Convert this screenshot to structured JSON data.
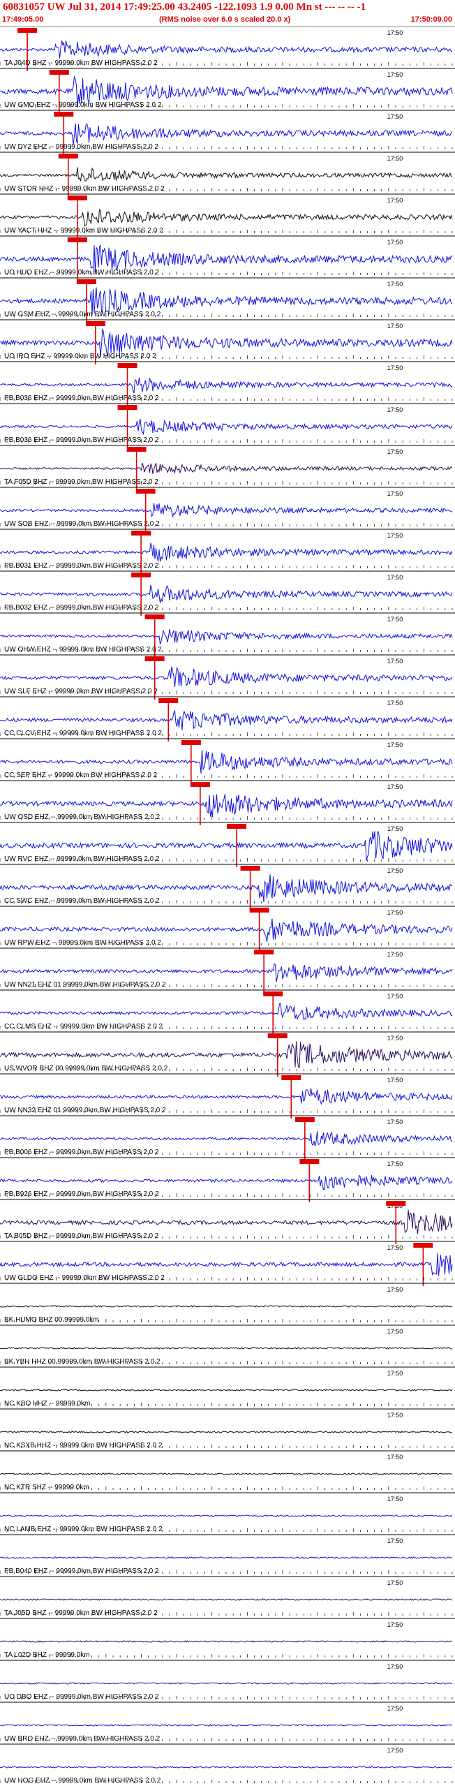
{
  "header": {
    "title": "60831057 UW Jul 31, 2014 17:49:25.00   43.2405 -122.1093  1.9 0.00 Mn st --- -- --  -1",
    "start_time": "17:49:05.00",
    "note": "(RMS noise over 6.0 s scaled 20.0 x)",
    "end_time": "17:50:09.00"
  },
  "chart_data": {
    "type": "line",
    "title": "60831057 UW Jul 31, 2014 17:49:25.00   43.2405 -122.1093  1.9 0.00 Mn st --- -- --  -1",
    "time_start": "17:49:05.00",
    "time_end": "17:50:09.00",
    "mid_tick_label": "17:50",
    "colors": {
      "trace_blue": "#1111dd",
      "trace_dark": "#2a0a5a",
      "trace_black": "#111111",
      "pick": "#e00000",
      "text": "#000000"
    },
    "traces": [
      {
        "label": "TA J04D BHZ -- 99999.0km BW  HIGHPASS  2.0  2",
        "color": "blue",
        "pick": 0.06,
        "event": 0.12,
        "amp": 0.6
      },
      {
        "label": "UW GMO EHZ -- 99999.0km BW  HIGHPASS  2.0  2",
        "color": "blue",
        "pick": 0.13,
        "event": 0.16,
        "amp": 1.0
      },
      {
        "label": "UW DY2 EHZ -- 99999.0km BW  HIGHPASS  2.0  2",
        "color": "blue",
        "pick": 0.14,
        "event": 0.16,
        "amp": 0.7
      },
      {
        "label": "UW STOR HHZ -- 99999.0km BW  HIGHPASS  2.0  2",
        "color": "black",
        "pick": 0.15,
        "event": 0.17,
        "amp": 0.5
      },
      {
        "label": "UW YACT HHZ -- 99999.0km BW  HIGHPASS  2.0  2",
        "color": "black",
        "pick": 0.17,
        "event": 0.18,
        "amp": 0.6
      },
      {
        "label": "UO HUO EHZ -- 99999.0km BW  HIGHPASS  2.0  2",
        "color": "blue",
        "pick": 0.17,
        "event": 0.2,
        "amp": 0.9
      },
      {
        "label": "UW GSM EHZ -- 99999.0km BW  HIGHPASS  2.0  2",
        "color": "blue",
        "pick": 0.19,
        "event": 0.2,
        "amp": 0.9
      },
      {
        "label": "UO IRO EHZ -- 99999.0km BW  HIGHPASS  2.0  2",
        "color": "blue",
        "pick": 0.21,
        "event": 0.22,
        "amp": 0.9
      },
      {
        "label": "PB B036 EHZ -- 99999.0km BW  HIGHPASS  2.0  2",
        "color": "blue",
        "pick": 0.28,
        "event": 0.29,
        "amp": 0.5
      },
      {
        "label": "PB B036 EHZ -- 99999.0km BW  HIGHPASS  2.0  2",
        "color": "blue",
        "pick": 0.28,
        "event": 0.3,
        "amp": 0.5
      },
      {
        "label": "TA F05D BHZ -- 99999.0km BW  HIGHPASS  2.0  2",
        "color": "dark",
        "pick": 0.3,
        "event": 0.31,
        "amp": 0.4
      },
      {
        "label": "UW SOB EHZ -- 99999.0km BW  HIGHPASS  2.0  2",
        "color": "blue",
        "pick": 0.32,
        "event": 0.33,
        "amp": 0.5
      },
      {
        "label": "PB B031 EHZ -- 99999.0km BW  HIGHPASS  2.0  2",
        "color": "blue",
        "pick": 0.31,
        "event": 0.33,
        "amp": 0.6
      },
      {
        "label": "PB B032 EHZ -- 99999.0km BW  HIGHPASS  2.0  2",
        "color": "blue",
        "pick": 0.31,
        "event": 0.33,
        "amp": 0.6
      },
      {
        "label": "UW OHW EHZ -- 99999.0km BW  HIGHPASS  2.0  2",
        "color": "blue",
        "pick": 0.34,
        "event": 0.35,
        "amp": 0.5
      },
      {
        "label": "UW SLF EHZ -- 99999.0km BW  HIGHPASS  2.0  2",
        "color": "blue",
        "pick": 0.34,
        "event": 0.37,
        "amp": 0.7
      },
      {
        "label": "CC CLCV EHZ -- 99999.0km BW  HIGHPASS  2.0  2",
        "color": "blue",
        "pick": 0.37,
        "event": 0.38,
        "amp": 0.7
      },
      {
        "label": "CC SEP EHZ -- 99999.0km BW  HIGHPASS  2.0  2",
        "color": "blue",
        "pick": 0.42,
        "event": 0.44,
        "amp": 0.7
      },
      {
        "label": "UW OSD EHZ -- 99999.0km BW  HIGHPASS  2.0  2",
        "color": "blue",
        "pick": 0.44,
        "event": 0.45,
        "amp": 0.9
      },
      {
        "label": "UW RVC EHZ -- 99999.0km BW  HIGHPASS  2.0  2",
        "color": "blue",
        "pick": 0.52,
        "event": 0.8,
        "amp": 1.0
      },
      {
        "label": "CC SWC EHZ -- 99999.0km BW  HIGHPASS  2.0  2",
        "color": "blue",
        "pick": 0.55,
        "event": 0.57,
        "amp": 0.9
      },
      {
        "label": "UW RPW EHZ -- 99999.0km BW  HIGHPASS  2.0  2",
        "color": "blue",
        "pick": 0.57,
        "event": 0.58,
        "amp": 0.8
      },
      {
        "label": "UW NN21 EHZ 01 99999.0km BW  HIGHPASS  2.0  2",
        "color": "blue",
        "pick": 0.58,
        "event": 0.6,
        "amp": 0.7
      },
      {
        "label": "CC CLMS EHZ -- 99999.0km BW  HIGHPASS  2.0  2",
        "color": "blue",
        "pick": 0.6,
        "event": 0.61,
        "amp": 0.6
      },
      {
        "label": "US WVOR BHZ 00 99999.0km BW  HIGHPASS  2.0  2",
        "color": "dark",
        "pick": 0.61,
        "event": 0.63,
        "amp": 0.9
      },
      {
        "label": "UW NN32 EHZ 01 99999.0km BW  HIGHPASS  2.0  2",
        "color": "blue",
        "pick": 0.64,
        "event": 0.66,
        "amp": 0.6
      },
      {
        "label": "PB B006 EHZ -- 99999.0km BW  HIGHPASS  2.0  2",
        "color": "blue",
        "pick": 0.67,
        "event": 0.68,
        "amp": 0.5
      },
      {
        "label": "PB B926 EHZ -- 99999.0km BW  HIGHPASS  2.0  2",
        "color": "blue",
        "pick": 0.68,
        "event": 0.7,
        "amp": 0.6
      },
      {
        "label": "TA B05D BHZ -- 99999.0km BW  HIGHPASS  2.0  2",
        "color": "dark",
        "pick": 0.87,
        "event": 0.89,
        "amp": 0.8
      },
      {
        "label": "UW GLDO EHZ -- 99999.0km BW  HIGHPASS  2.0  2",
        "color": "blue",
        "pick": 0.93,
        "event": 0.95,
        "amp": 0.8
      },
      {
        "label": "BK HUMO BHZ 00 99999.0km",
        "color": "black",
        "amp": 0.3
      },
      {
        "label": "BK YBH HHZ 00 99999.0km BW  HIGHPASS  2.0  2",
        "color": "black",
        "amp": 0.3
      },
      {
        "label": "NC KBO HHZ -- 99999.0km",
        "color": "black",
        "amp": 0.3
      },
      {
        "label": "NC KSXB HHZ -- 99999.0km BW  HIGHPASS  2.0  2",
        "color": "black",
        "amp": 0.3
      },
      {
        "label": "NC KTR SHZ -- 99999.0km",
        "color": "black",
        "amp": 0.3
      },
      {
        "label": "NC LAMB EHZ -- 99999.0km BW  HIGHPASS  2.0  2",
        "color": "blue",
        "amp": 0.3
      },
      {
        "label": "PB B040 EHZ -- 99999.0km BW  HIGHPASS  2.0  2",
        "color": "blue",
        "amp": 0.3
      },
      {
        "label": "TA J05D BHZ -- 99999.0km BW  HIGHPASS  2.0  2",
        "color": "dark",
        "amp": 0.3
      },
      {
        "label": "TA L02D BHZ -- 99999.0km",
        "color": "dark",
        "amp": 0.3
      },
      {
        "label": "UO DBO EHZ -- 99999.0km BW  HIGHPASS  2.0  2",
        "color": "blue",
        "amp": 0.3
      },
      {
        "label": "UW BRO EHZ -- 99999.0km BW  HIGHPASS  2.0  2",
        "color": "blue",
        "amp": 0.3
      },
      {
        "label": "UW HOG EHZ -- 99999.0km BW  HIGHPASS  2.0  2",
        "color": "blue",
        "amp": 0.3
      }
    ]
  }
}
